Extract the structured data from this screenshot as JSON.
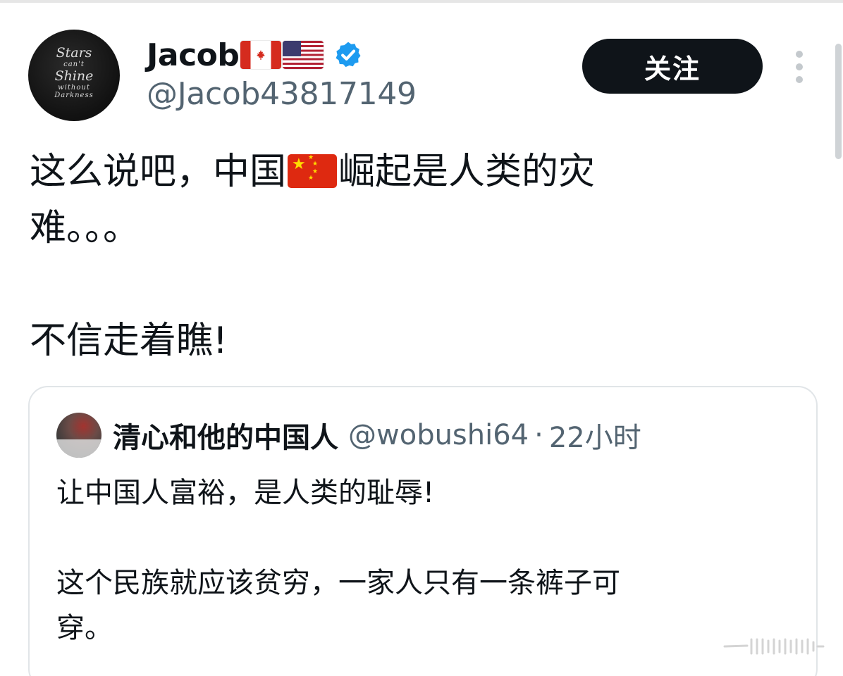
{
  "post": {
    "display_name": "Jacob",
    "name_flags": [
      "canada-flag",
      "united-states-flag"
    ],
    "verified_badge": "verified-badge-icon",
    "handle": "@Jacob43817149",
    "follow_label": "关注",
    "more_icon": "more-options-icon",
    "avatar_text": [
      "Stars",
      "can't",
      "Shine",
      "without",
      "Darkness"
    ],
    "text_line1_before_flag": "这么说吧，中国",
    "inline_flag": "china-flag",
    "text_line1_after_flag": "崛起是人类的灾",
    "text_line2": "难。。。",
    "text_line3": "不信走着瞧!"
  },
  "quoted_post": {
    "display_name": "清心和他的中国人",
    "handle": "@wobushi64",
    "separator": "·",
    "time": "22小时",
    "text_line1": "让中国人富裕，是人类的耻辱!",
    "text_line2": "这个民族就应该贫穷，一家人只有一条裤子可",
    "text_line3": "穿。"
  },
  "colors": {
    "text_primary": "#0f1419",
    "text_secondary": "#536471",
    "verified_blue": "#1d9bf0",
    "follow_button_bg": "#0f1419",
    "card_border": "#e1e5e8"
  }
}
